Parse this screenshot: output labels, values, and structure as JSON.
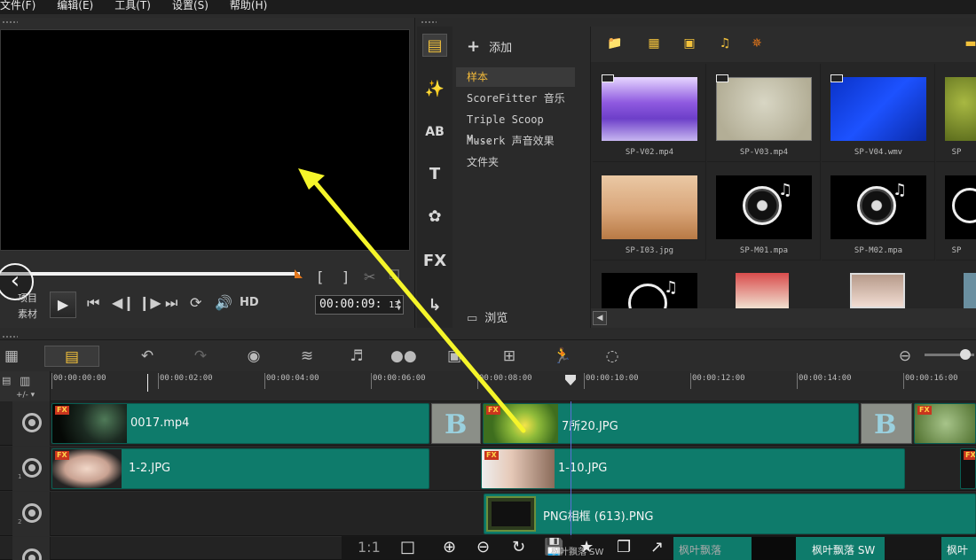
{
  "menu": [
    "文件(F)",
    "编辑(E)",
    "工具(T)",
    "设置(S)",
    "帮助(H)"
  ],
  "preview": {
    "mode_project": "项目",
    "mode_clip": "素材",
    "timecode": "00:00:09:",
    "timecode_frames": "13",
    "hd_label": "HD",
    "bracket_in": "[",
    "bracket_out": "]"
  },
  "library": {
    "add_label": "添加",
    "browse_label": "浏览",
    "folders": [
      "样本",
      "ScoreFitter 音乐",
      "Triple Scoop M...",
      "Muserk 声音效果",
      "文件夹"
    ],
    "selected_folder": 0,
    "thumbnails": [
      {
        "caption": "SP-V02.mp4",
        "kind": "video"
      },
      {
        "caption": "SP-V03.mp4",
        "kind": "video"
      },
      {
        "caption": "SP-V04.wmv",
        "kind": "video"
      },
      {
        "caption": "SP",
        "kind": "video"
      },
      {
        "caption": "SP-I03.jpg",
        "kind": "image"
      },
      {
        "caption": "SP-M01.mpa",
        "kind": "audio"
      },
      {
        "caption": "SP-M02.mpa",
        "kind": "audio"
      },
      {
        "caption": "SP",
        "kind": "audio"
      }
    ]
  },
  "ruler": {
    "ticks": [
      "00:00:00:00",
      "00:00:02:00",
      "00:00:04:00",
      "00:00:06:00",
      "00:00:08:00",
      "00:00:10:00",
      "00:00:12:00",
      "00:00:14:00",
      "00:00:16:00"
    ]
  },
  "tracks": {
    "video": {
      "clips": [
        {
          "label": "0017.mp4"
        },
        {
          "label": "7所20.JPG"
        }
      ]
    },
    "overlay1": {
      "clips": [
        {
          "label": "1-2.JPG"
        },
        {
          "label": "1-10.JPG"
        }
      ]
    },
    "overlay2": {
      "clips": [
        {
          "label": "PNG相框 (613).PNG"
        }
      ]
    }
  },
  "viewer_bar": {
    "ratio": "1:1",
    "strip1": "枫叶飘落 SW",
    "strip2": "枫叶飘落",
    "strip3": "枫叶飘落 SW",
    "strip4": "枫叶"
  },
  "colors": {
    "clip_teal": "#0e7b6b",
    "accent_yellow": "#f3c23c",
    "arrow_yellow": "#f5f52a",
    "scrub_orange": "#e2761b"
  }
}
